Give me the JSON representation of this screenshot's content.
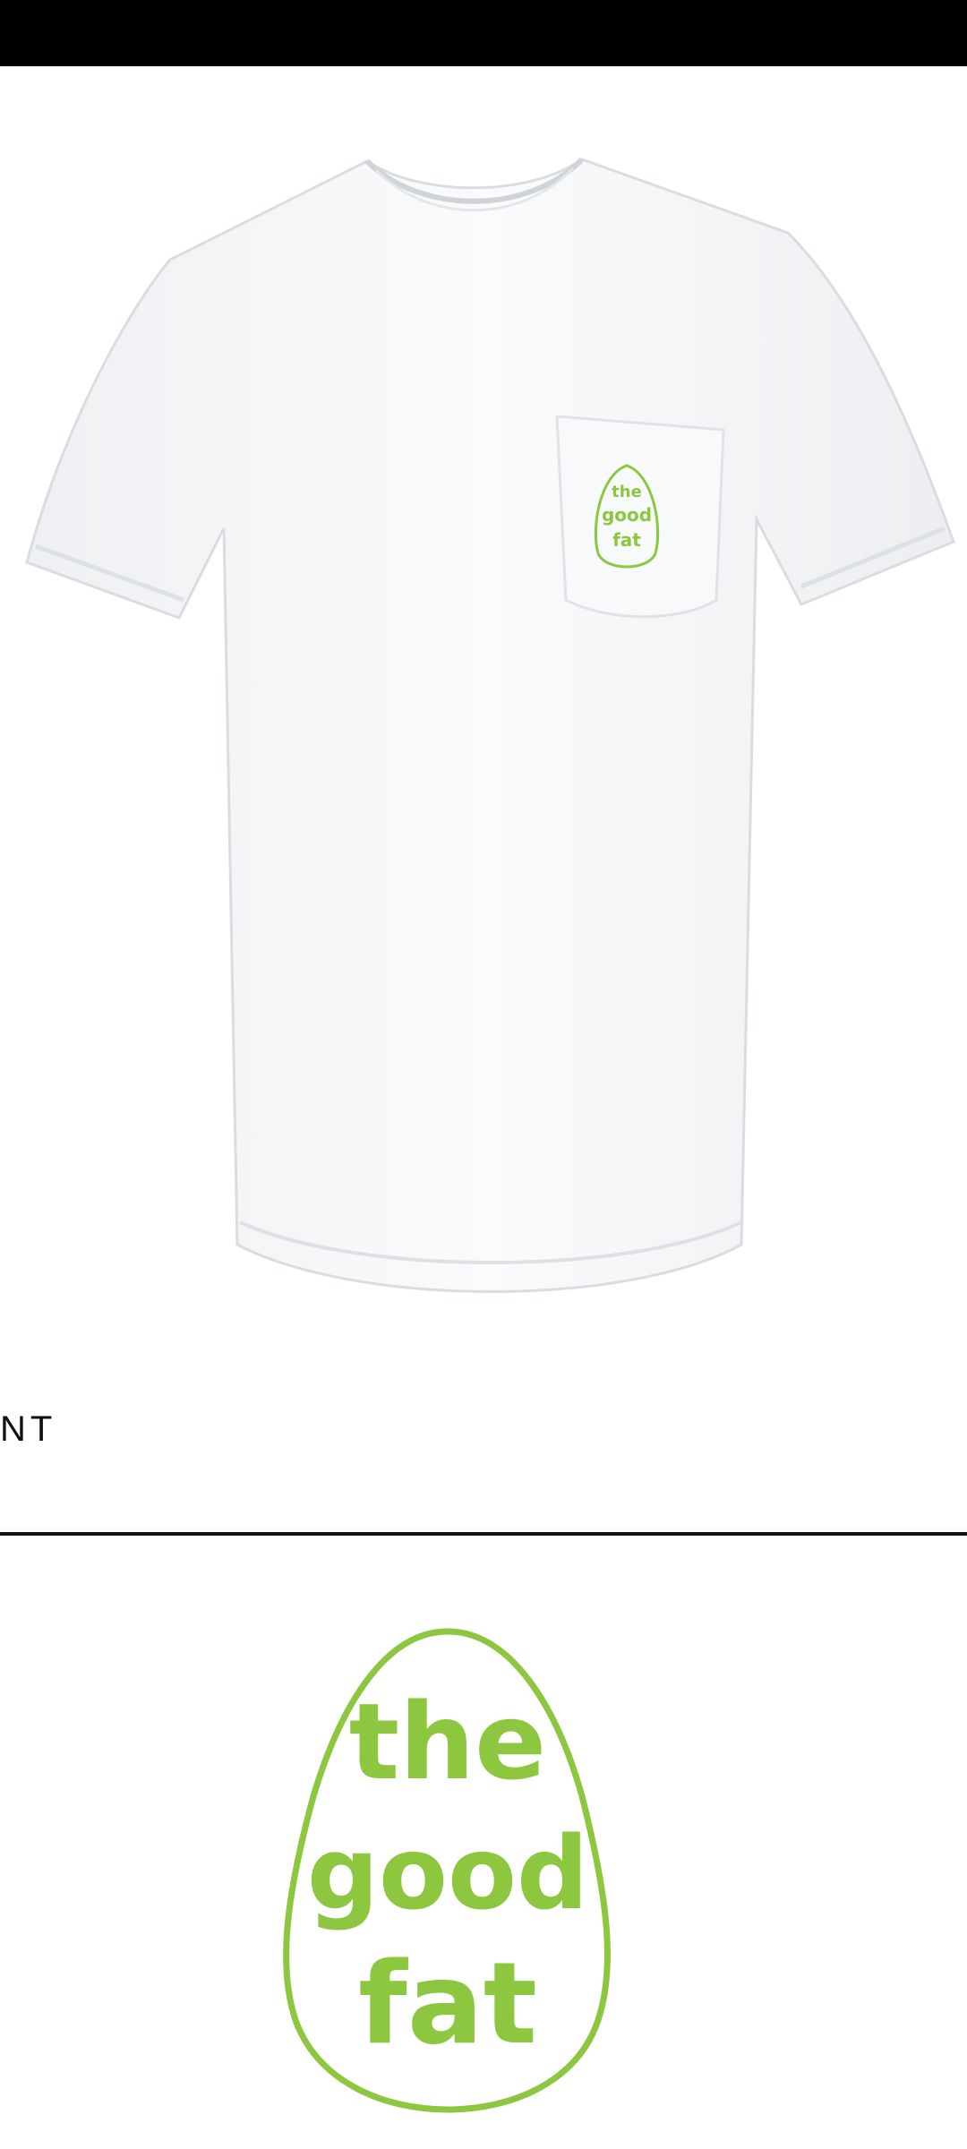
{
  "front_label": "NT",
  "logo": {
    "line1": "the",
    "line2": "good",
    "line3": "fat"
  },
  "colors": {
    "topbar": "#000000",
    "logo_green": "#8DC63F",
    "shirt": "#F7F8FA",
    "divider": "#111111"
  }
}
